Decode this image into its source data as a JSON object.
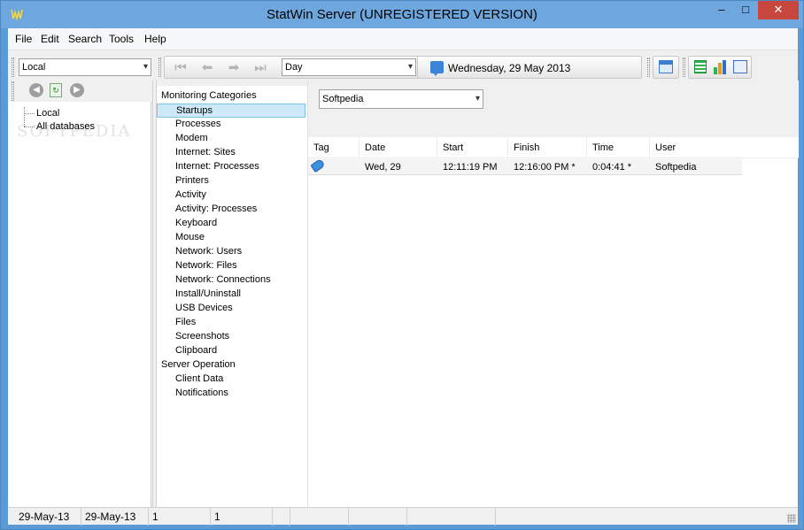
{
  "window": {
    "title": "StatWin Server (UNREGISTERED VERSION)",
    "icon": "statwin-app-icon",
    "controls": {
      "minimize": "–",
      "maximize": "□",
      "close": "✕"
    }
  },
  "menu": [
    "File",
    "Edit",
    "Search",
    "Tools",
    "Help"
  ],
  "toolbar": {
    "source_combo": "Local",
    "period_combo": "Day",
    "date_label": "Wednesday, 29 May 2013",
    "nav_icons": [
      "first-icon",
      "back-icon",
      "forward-icon",
      "last-icon"
    ],
    "view_icons": [
      "calendar-icon",
      "list-view-icon",
      "bar-chart-icon",
      "statistics-icon"
    ]
  },
  "left_pane": {
    "watermark": "SOFTPEDIA",
    "tree": [
      {
        "label": "Local"
      },
      {
        "label": "All databases"
      }
    ]
  },
  "categories": [
    {
      "label": "Monitoring Categories",
      "level": 0
    },
    {
      "label": "Startups",
      "level": 1,
      "selected": true
    },
    {
      "label": "Processes",
      "level": 1
    },
    {
      "label": "Modem",
      "level": 1
    },
    {
      "label": "Internet: Sites",
      "level": 1
    },
    {
      "label": "Internet: Processes",
      "level": 1
    },
    {
      "label": "Printers",
      "level": 1
    },
    {
      "label": "Activity",
      "level": 1
    },
    {
      "label": "Activity: Processes",
      "level": 1
    },
    {
      "label": "Keyboard",
      "level": 1
    },
    {
      "label": "Mouse",
      "level": 1
    },
    {
      "label": "Network: Users",
      "level": 1
    },
    {
      "label": "Network: Files",
      "level": 1
    },
    {
      "label": "Network: Connections",
      "level": 1
    },
    {
      "label": "Install/Uninstall",
      "level": 1
    },
    {
      "label": "USB Devices",
      "level": 1
    },
    {
      "label": "Files",
      "level": 1
    },
    {
      "label": "Screenshots",
      "level": 1
    },
    {
      "label": "Clipboard",
      "level": 1
    },
    {
      "label": "Server Operation",
      "level": 0
    },
    {
      "label": "Client Data",
      "level": 1
    },
    {
      "label": "Notifications",
      "level": 1
    }
  ],
  "content": {
    "user_combo": "Softpedia",
    "columns": [
      "Tag",
      "Date",
      "Start",
      "Finish",
      "Time",
      "User"
    ],
    "rows": [
      {
        "tag_icon": "tag-icon",
        "date": "Wed, 29",
        "start": "12:11:19 PM",
        "finish": "12:16:00 PM *",
        "time": "0:04:41 *",
        "user": "Softpedia"
      }
    ]
  },
  "status": [
    "29-May-13",
    "29-May-13",
    "1",
    "1"
  ]
}
